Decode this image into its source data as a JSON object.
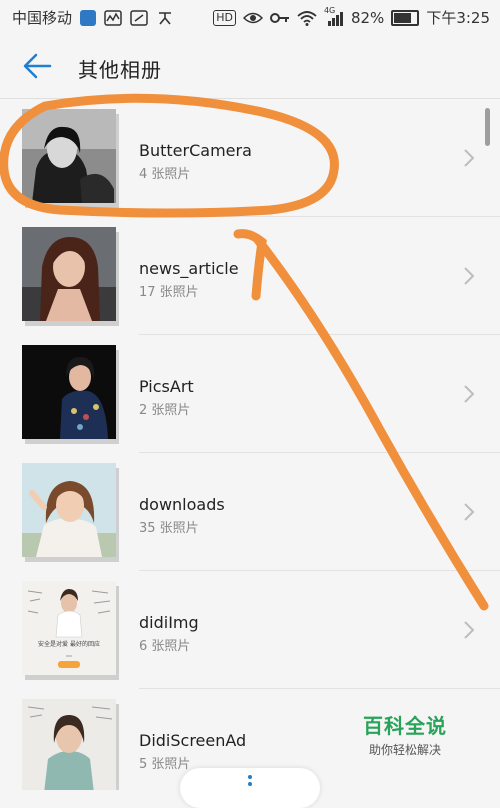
{
  "status_bar": {
    "carrier": "中国移动",
    "hd": "HD",
    "signal_tag": "4G",
    "battery": "82%",
    "battery_level": 0.82,
    "time": "下午3:25"
  },
  "header": {
    "title": "其他相册"
  },
  "albums": [
    {
      "name": "ButterCamera",
      "count": "4 张照片"
    },
    {
      "name": "news_article",
      "count": "17 张照片"
    },
    {
      "name": "PicsArt",
      "count": "2 张照片"
    },
    {
      "name": "downloads",
      "count": "35 张照片"
    },
    {
      "name": "didiImg",
      "count": "6 张照片"
    },
    {
      "name": "DidiScreenAd",
      "count": "5 张照片"
    }
  ],
  "promo_text": {
    "line1": "安全是对爱 最好的回应"
  },
  "watermark": {
    "title": "百科全说",
    "subtitle": "助你轻松解决"
  },
  "colors": {
    "accent": "#1f7fd0",
    "annotation": "#f0903c",
    "watermark_green": "#29a35a"
  }
}
